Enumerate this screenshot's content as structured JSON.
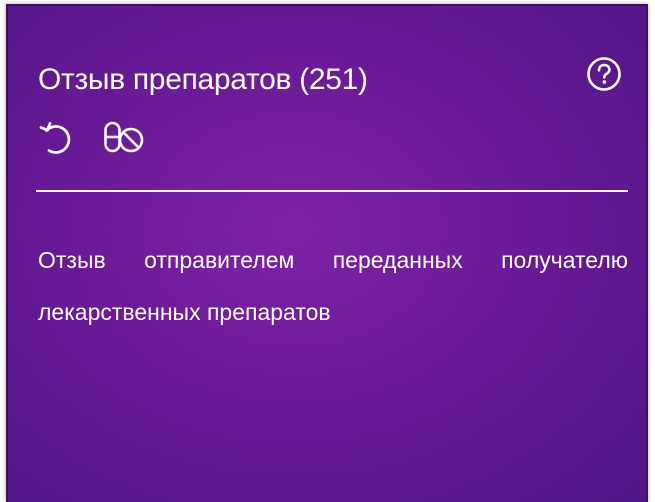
{
  "card": {
    "title": "Отзыв препаратов (251)",
    "description": "Отзыв отправителем переданных получателю лекарственных препаратов",
    "background_color": "#6a1a97",
    "text_color": "#ffffff"
  },
  "icons": {
    "help": "help-circle-icon",
    "revert": "undo-arrow-icon",
    "medicine": "pills-icon"
  }
}
